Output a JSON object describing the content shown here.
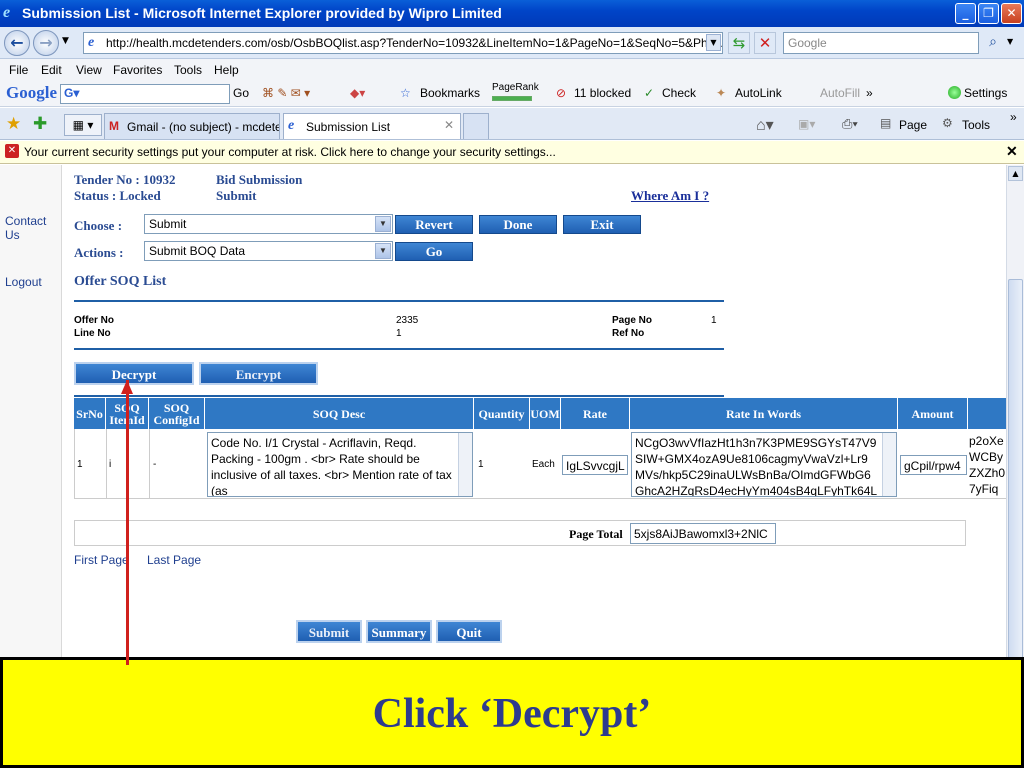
{
  "window": {
    "title": "Submission List - Microsoft Internet Explorer provided by Wipro Limited",
    "address": "http://health.mcdetenders.com/osb/OsbBOQlist.asp?TenderNo=10932&LineItemNo=1&PageNo=1&SeqNo=5&PhyActCode=",
    "search_placeholder": "Google"
  },
  "menu": [
    "File",
    "Edit",
    "View",
    "Favorites",
    "Tools",
    "Help"
  ],
  "google_toolbar": {
    "logo": "Google",
    "go": "Go",
    "bookmarks": "Bookmarks",
    "pagerank": "PageRank",
    "blocked": "11 blocked",
    "check": "Check",
    "autolink": "AutoLink",
    "autofill": "AutoFill",
    "settings": "Settings"
  },
  "tabs": [
    {
      "label": "Gmail - (no subject) - mcdete..."
    },
    {
      "label": "Submission List"
    }
  ],
  "command_bar": {
    "page": "Page",
    "tools": "Tools"
  },
  "infobar": {
    "text": "Your current security settings put your computer at risk. Click here to change your security settings..."
  },
  "nav": {
    "contact": "Contact Us",
    "logout": "Logout"
  },
  "header": {
    "tender": "Tender No : 10932",
    "status": "Status : Locked",
    "bid": "Bid Submission",
    "submit": "Submit",
    "where": "Where Am I ?"
  },
  "choose": {
    "label": "Choose :",
    "value": "Submit"
  },
  "actions": {
    "label": "Actions :",
    "value": "Submit BOQ Data"
  },
  "buttons": {
    "revert": "Revert",
    "done": "Done",
    "exit": "Exit",
    "go": "Go",
    "decrypt": "Decrypt",
    "encrypt": "Encrypt",
    "submit": "Submit",
    "summary": "Summary",
    "quit": "Quit"
  },
  "offer": {
    "title": "Offer SOQ List",
    "offer_no_label": "Offer No",
    "offer_no": "2335",
    "line_no_label": "Line No",
    "line_no": "1",
    "page_no_label": "Page No",
    "page_no": "1",
    "ref_no_label": "Ref No"
  },
  "table": {
    "headers": [
      "SrNo",
      "SOQ ItemId",
      "SOQ ConfigId",
      "SOQ Desc",
      "Quantity",
      "UOM",
      "Rate",
      "Rate In Words",
      "Amount"
    ],
    "row": {
      "srno": "1",
      "itemid": "i",
      "configid": "-",
      "desc": "Code No. I/1  Crystal - Acriflavin, Reqd. Packing - 100gm . <br> Rate should be inclusive of all taxes. <br> Mention rate of tax (as",
      "quantity": "1",
      "uom": "Each",
      "rate": "IgLSvvcgjL",
      "rate_words": "NCgO3wvVfIazHt1h3n7K3PME9SGYsT47V9 SIW+GMX4ozA9Ue8106cagmyVwaVzl+Lr9 MVs/hkp5C29inaULWsBnBa/OImdGFWbG6 GhcA2HZqRsD4ecHyYm404sB4qLFyhTk64L",
      "amount": "gCpil/rpw4",
      "extra": "p2oXe WCBy ZXZh0 7yFiq"
    },
    "page_total_label": "Page Total",
    "page_total": "5xjs8AiJBawomxl3+2NlC"
  },
  "paging": {
    "first": "First Page",
    "last": "Last Page"
  },
  "caption": "Click ‘Decrypt’"
}
